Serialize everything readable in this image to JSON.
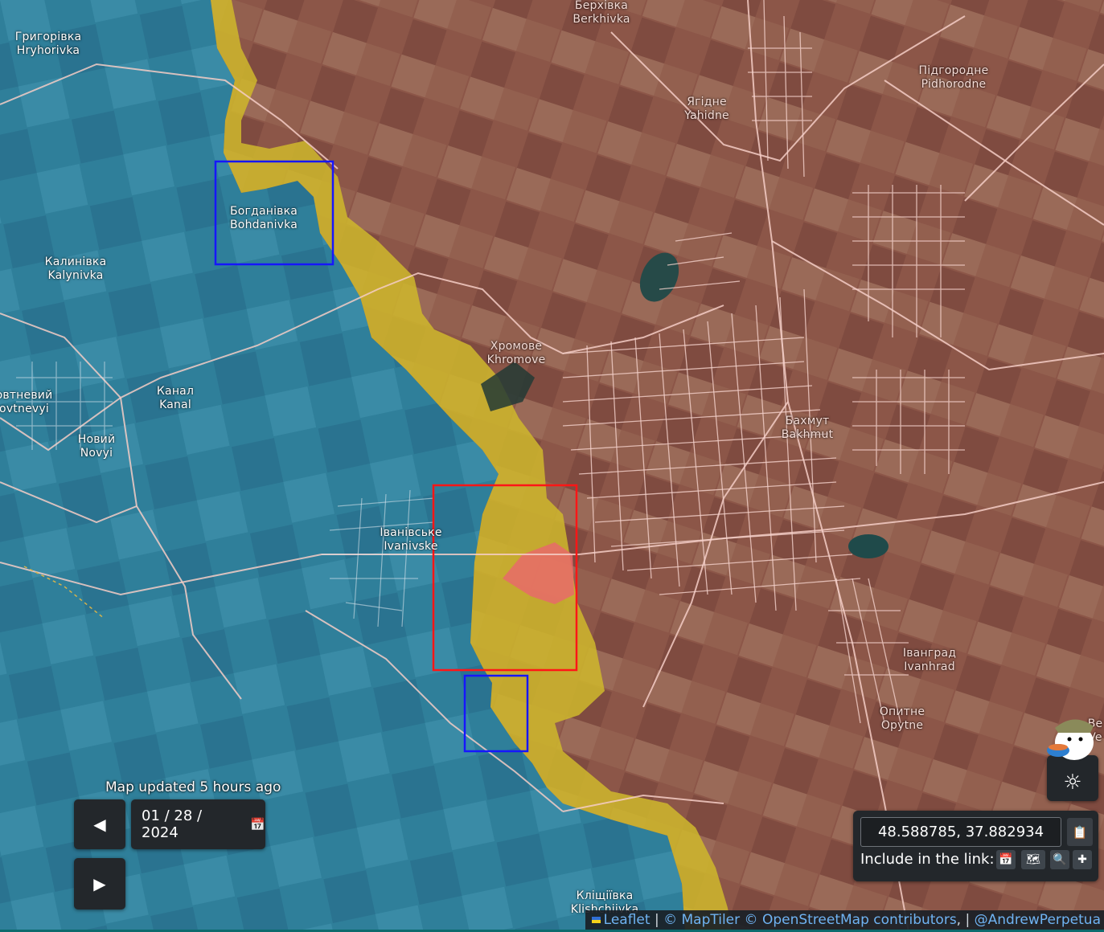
{
  "map": {
    "colors": {
      "occupied": "#8a4f45",
      "ukraine_controlled": "#3b8fb0",
      "contested": "#c9b430",
      "recent_advance": "#e06060",
      "highlight_red": "#ff1a1a",
      "highlight_blue": "#1a1aff",
      "roads": "#f3c8c2"
    },
    "labels": {
      "berkhivka_uk": "Берхівка",
      "berkhivka_en": "Berkhivka",
      "hryhorivka_uk": "Григорівка",
      "hryhorivka_en": "Hryhorivka",
      "pidhorodne_uk": "Підгородне",
      "pidhorodne_en": "Pidhorodne",
      "yahidne_uk": "Ягідне",
      "yahidne_en": "Yahidne",
      "bohdanivka_uk": "Богданівка",
      "bohdanivka_en": "Bohdanivka",
      "kalynivka_uk": "Калинівка",
      "kalynivka_en": "Kalynivka",
      "khromove_uk": "Хромове",
      "khromove_en": "Khromove",
      "zhovtnevyi_uk": "овтневий",
      "zhovtnevyi_en": "ovtnevyi",
      "kanal_uk": "Канал",
      "kanal_en": "Kanal",
      "novyi_uk": "Новий",
      "novyi_en": "Novyi",
      "bakhmut_uk": "Бахмут",
      "bakhmut_en": "Bakhmut",
      "ivanivske_uk": "Іванівське",
      "ivanivske_en": "Ivanivske",
      "ivanhrad_uk": "Іванград",
      "ivanhrad_en": "Ivanhrad",
      "opytne_uk": "Опитне",
      "opytne_en": "Opytne",
      "klishchiivka_uk": "Кліщіївка",
      "klishchiivka_en": "Klishchiivka",
      "edge_be": "Be",
      "edge_ve": "Ve"
    }
  },
  "timeline": {
    "updated": "Map updated 5 hours ago",
    "date": "01 / 28 / 2024",
    "prev_icon": "◀",
    "next_icon": "▶"
  },
  "coords": {
    "value": "48.588785, 37.882934",
    "include_label": "Include in the link:",
    "include_icons": [
      "calendar-icon",
      "map-icon",
      "zoom-icon",
      "crosshair-icon"
    ]
  },
  "attribution": {
    "leaflet": "Leaflet",
    "maptiler": "© MapTiler",
    "osm": "© OpenStreetMap contributors",
    "author": "@AndrewPerpetua"
  }
}
